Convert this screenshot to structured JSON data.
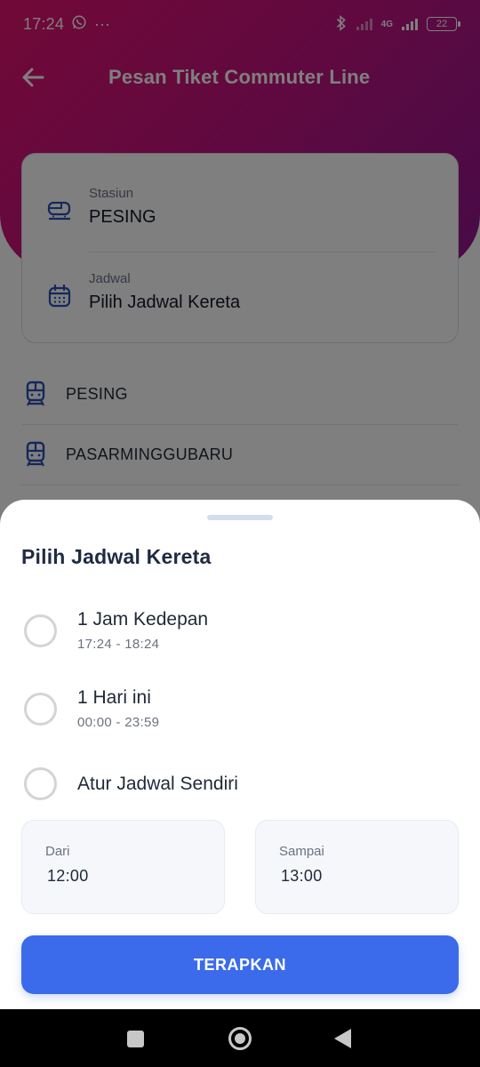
{
  "status_bar": {
    "time": "17:24",
    "more": "···",
    "network": "4G",
    "battery": "22"
  },
  "header": {
    "title": "Pesan Tiket Commuter Line"
  },
  "form": {
    "station_label": "Stasiun",
    "station_value": "PESING",
    "schedule_label": "Jadwal",
    "schedule_value": "Pilih Jadwal Kereta"
  },
  "stations": [
    {
      "name": "PESING"
    },
    {
      "name": "PASARMINGGUBARU"
    }
  ],
  "sheet": {
    "title": "Pilih Jadwal Kereta",
    "options": [
      {
        "label": "1 Jam Kedepan",
        "sub": "17:24 - 18:24",
        "selected": false
      },
      {
        "label": "1 Hari ini",
        "sub": "00:00 - 23:59",
        "selected": false
      },
      {
        "label": "Atur Jadwal Sendiri",
        "selected": false
      }
    ],
    "from_label": "Dari",
    "from_value": "12:00",
    "to_label": "Sampai",
    "to_value": "13:00",
    "apply_label": "TERAPKAN"
  },
  "colors": {
    "brand_pink": "#e3126f",
    "brand_purple": "#8f168f",
    "primary_blue": "#3b6bea",
    "icon_blue": "#2b4fb8"
  },
  "icons": {
    "back": "arrow-left-icon",
    "station": "train-front-icon",
    "schedule": "calendar-icon",
    "station_item": "train-icon",
    "whatsapp": "whatsapp-icon",
    "bluetooth": "bluetooth-icon",
    "signal": "signal-icon",
    "battery": "battery-icon"
  }
}
